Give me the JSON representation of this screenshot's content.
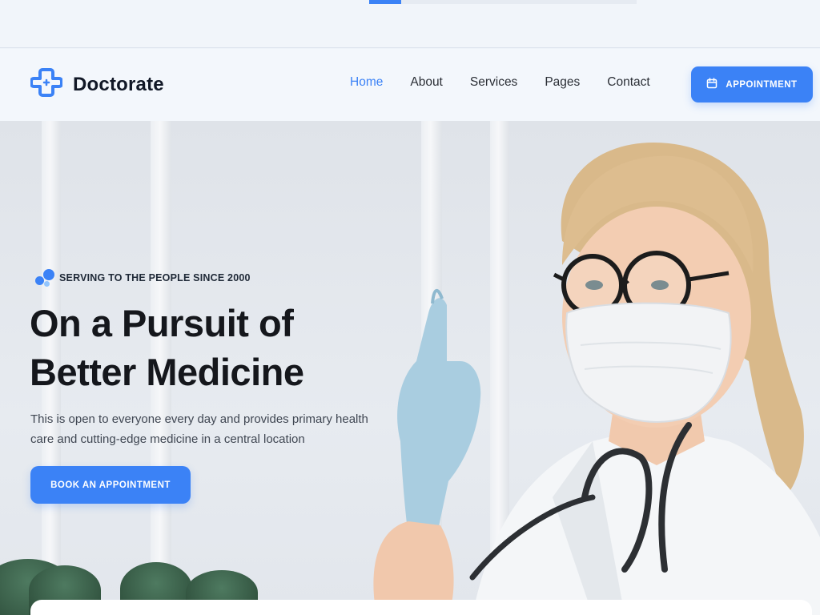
{
  "top_progress": {
    "fraction": 0.12
  },
  "brand": {
    "name": "Doctorate",
    "accent_color": "#3b82f6",
    "logo_icon": "medical-cross-icon"
  },
  "nav": {
    "items": [
      {
        "label": "Home",
        "active": true
      },
      {
        "label": "About",
        "active": false
      },
      {
        "label": "Services",
        "active": false
      },
      {
        "label": "Pages",
        "active": false
      },
      {
        "label": "Contact",
        "active": false
      }
    ],
    "appointment_label": "APPOINTMENT",
    "appointment_icon": "calendar-icon"
  },
  "hero": {
    "tagline": "SERVING TO THE PEOPLE SINCE 2000",
    "headline_line1": "On a Pursuit of",
    "headline_line2": "Better Medicine",
    "description": "This is open to everyone every day and provides primary health care and cutting-edge medicine in a central location",
    "cta_label": "BOOK AN APPOINTMENT",
    "image": "doctor-with-mask-photo"
  }
}
